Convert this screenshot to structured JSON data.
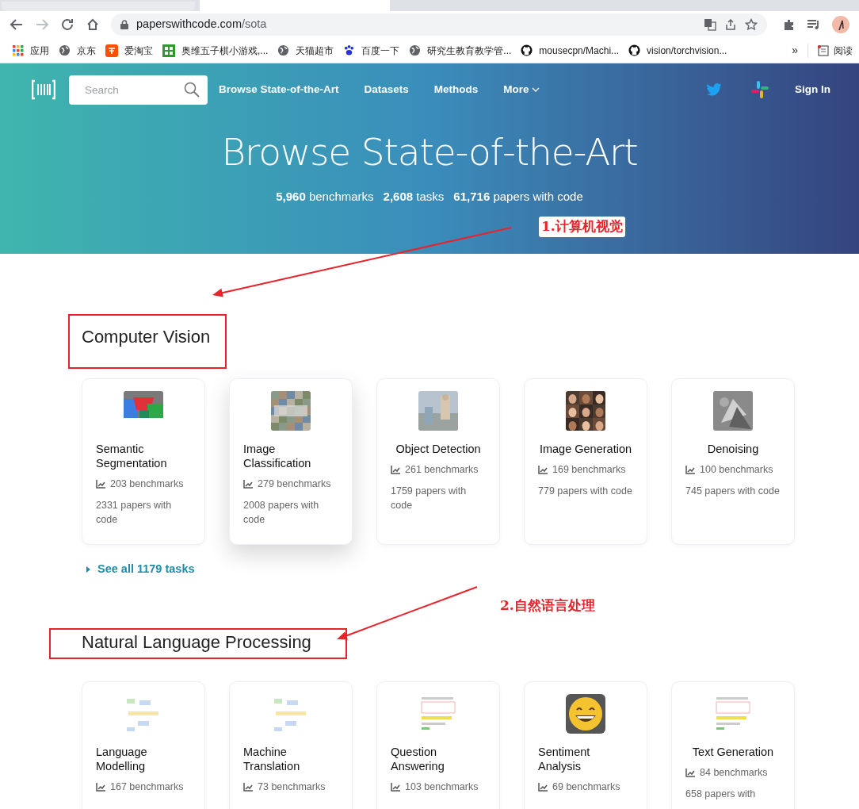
{
  "browser": {
    "url_host": "paperswithcode.com",
    "url_path": "/sota",
    "bookmarks": [
      {
        "label": "应用"
      },
      {
        "label": "京东"
      },
      {
        "label": "爱淘宝"
      },
      {
        "label": "奥维五子棋小游戏,..."
      },
      {
        "label": "天猫超市"
      },
      {
        "label": "百度一下"
      },
      {
        "label": "研究生教育教学管..."
      },
      {
        "label": "mousecpn/Machi..."
      },
      {
        "label": "vision/torchvision..."
      }
    ],
    "overflow": "»",
    "reading_list": "阅读"
  },
  "nav": {
    "search_placeholder": "Search",
    "links": [
      "Browse State-of-the-Art",
      "Datasets",
      "Methods"
    ],
    "more": "More",
    "sign_in": "Sign In"
  },
  "hero": {
    "title": "Browse State-of-the-Art",
    "stats": [
      "**5,960** benchmarks",
      "**2,608** tasks",
      "**61,716** papers with code"
    ]
  },
  "sections": [
    {
      "title": "Computer Vision",
      "see_all": "See all 1179 tasks",
      "annotation": "1.计算机视觉",
      "cards": [
        {
          "title": "Semantic Segmentation",
          "benchmarks": "203 benchmarks",
          "papers": "2331 papers with code",
          "raised": false
        },
        {
          "title": "Image Classification",
          "benchmarks": "279 benchmarks",
          "papers": "2008 papers with code",
          "raised": true
        },
        {
          "title": "Object Detection",
          "benchmarks": "261 benchmarks",
          "papers": "1759 papers with code",
          "raised": false
        },
        {
          "title": "Image Generation",
          "benchmarks": "169 benchmarks",
          "papers": "779 papers with code",
          "raised": false
        },
        {
          "title": "Denoising",
          "benchmarks": "100 benchmarks",
          "papers": "745 papers with code",
          "raised": false
        }
      ]
    },
    {
      "title": "Natural Language Processing",
      "annotation": "2.自然语言处理",
      "cards": [
        {
          "title": "Language Modelling",
          "benchmarks": "167 benchmarks",
          "raised": false
        },
        {
          "title": "Machine Translation",
          "benchmarks": "73 benchmarks",
          "raised": false
        },
        {
          "title": "Question Answering",
          "benchmarks": "103 benchmarks",
          "raised": false
        },
        {
          "title": "Sentiment Analysis",
          "benchmarks": "69 benchmarks",
          "raised": false
        },
        {
          "title": "Text Generation",
          "benchmarks": "84 benchmarks",
          "papers": "658 papers with",
          "raised": false
        }
      ]
    }
  ]
}
